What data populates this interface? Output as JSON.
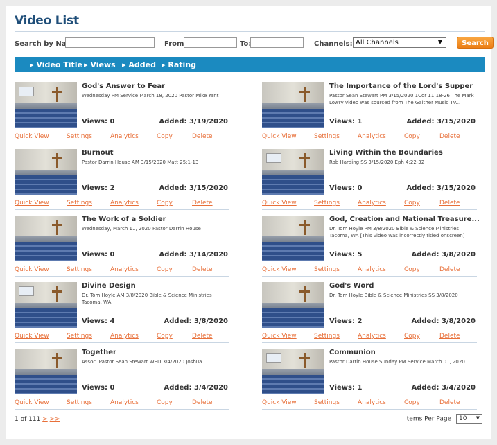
{
  "page_title": "Video List",
  "search": {
    "name_label": "Search by Name:",
    "from_label": "From:",
    "to_label": "To:",
    "channels_label": "Channels:",
    "channels_value": "All Channels",
    "button_label": "Search"
  },
  "sortbar": {
    "items": [
      "Video Title",
      "Views",
      "Added",
      "Rating"
    ]
  },
  "actions": {
    "quick_view": "Quick View",
    "settings": "Settings",
    "analytics": "Analytics",
    "copy": "Copy",
    "delete": "Delete"
  },
  "videos": [
    {
      "title": "God's Answer to Fear",
      "desc": "Wednesday PM Service March 18, 2020 Pastor Mike Yant",
      "views": "Views: 0",
      "added": "Added: 3/19/2020"
    },
    {
      "title": "The Importance of the Lord's Supper",
      "desc": "Pastor Sean Stewart PM 3/15/2020 1Cor 11:18-26 The Mark Lowry video was sourced from The Gaither Music TV...",
      "views": "Views: 1",
      "added": "Added: 3/15/2020"
    },
    {
      "title": "Burnout",
      "desc": "Pastor Darrin House AM 3/15/2020 Matt 25:1-13",
      "views": "Views: 2",
      "added": "Added: 3/15/2020"
    },
    {
      "title": "Living Within the Boundaries",
      "desc": "Rob Harding SS 3/15/2020 Eph 4:22-32",
      "views": "Views: 0",
      "added": "Added: 3/15/2020"
    },
    {
      "title": "The Work of a Soldier",
      "desc": "Wednesday, March 11, 2020 Pastor Darrin House",
      "views": "Views: 0",
      "added": "Added: 3/14/2020"
    },
    {
      "title": "God, Creation and National Treasure...",
      "desc": "Dr. Tom Hoyle PM 3/8/2020 Bible & Science Ministries Tacoma, WA [This video was incorrectly titled onscreen]",
      "views": "Views: 5",
      "added": "Added: 3/8/2020"
    },
    {
      "title": "Divine Design",
      "desc": "Dr. Tom Hoyle AM 3/8/2020 Bible & Science Ministries Tacoma, WA",
      "views": "Views: 4",
      "added": "Added: 3/8/2020"
    },
    {
      "title": "God's Word",
      "desc": "Dr. Tom Hoyle Bible & Science Ministries SS 3/8/2020",
      "views": "Views: 2",
      "added": "Added: 3/8/2020"
    },
    {
      "title": "Together",
      "desc": "Assoc. Pastor Sean Stewart WED 3/4/2020 Joshua",
      "views": "Views: 0",
      "added": "Added: 3/4/2020"
    },
    {
      "title": "Communion",
      "desc": "Pastor Darrin House Sunday PM Service March 01, 2020",
      "views": "Views: 1",
      "added": "Added: 3/4/2020"
    }
  ],
  "pager": {
    "text": "1 of 111",
    "next": ">",
    "last": ">>",
    "per_page_label": "Items Per Page",
    "per_page_value": "10"
  }
}
